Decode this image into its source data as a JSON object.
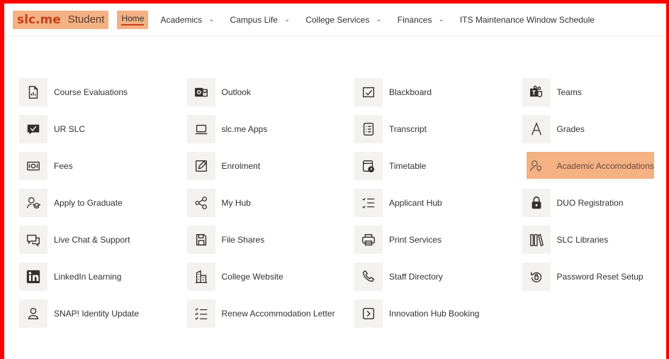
{
  "brand": {
    "logo": "slc.me",
    "name": "Student"
  },
  "nav": {
    "home": "Home",
    "items": [
      {
        "label": "Academics",
        "has_menu": true
      },
      {
        "label": "Campus Life",
        "has_menu": true
      },
      {
        "label": "College Services",
        "has_menu": true
      },
      {
        "label": "Finances",
        "has_menu": true
      },
      {
        "label": "ITS Maintenance Window Schedule",
        "has_menu": false
      }
    ]
  },
  "colors": {
    "frame": "#ff0000",
    "highlight": "#f4b183",
    "brand_text": "#c7401b"
  },
  "tiles": [
    {
      "label": "Course Evaluations",
      "icon": "document-chart-icon"
    },
    {
      "label": "Outlook",
      "icon": "outlook-icon"
    },
    {
      "label": "Blackboard",
      "icon": "blackboard-icon"
    },
    {
      "label": "Teams",
      "icon": "teams-icon"
    },
    {
      "label": "UR SLC",
      "icon": "chat-checkmark-icon"
    },
    {
      "label": "slc.me Apps",
      "icon": "laptop-icon"
    },
    {
      "label": "Transcript",
      "icon": "transcript-icon"
    },
    {
      "label": "Grades",
      "icon": "letter-a-icon"
    },
    {
      "label": "Fees",
      "icon": "money-icon"
    },
    {
      "label": "Enrolment",
      "icon": "edit-form-icon"
    },
    {
      "label": "Timetable",
      "icon": "calendar-clock-icon"
    },
    {
      "label": "Academic Accomodations",
      "icon": "person-lightbulb-icon",
      "highlighted": true
    },
    {
      "label": "Apply to Graduate",
      "icon": "person-graduation-icon"
    },
    {
      "label": "My Hub",
      "icon": "hub-nodes-icon"
    },
    {
      "label": "Applicant Hub",
      "icon": "checklist-icon"
    },
    {
      "label": "DUO Registration",
      "icon": "lock-icon"
    },
    {
      "label": "Live Chat & Support",
      "icon": "chat-bubble-icon"
    },
    {
      "label": "File Shares",
      "icon": "save-disk-icon"
    },
    {
      "label": "Print Services",
      "icon": "printer-icon"
    },
    {
      "label": "SLC Libraries",
      "icon": "library-books-icon"
    },
    {
      "label": "LinkedIn Learning",
      "icon": "linkedin-icon"
    },
    {
      "label": "College Website",
      "icon": "building-icon"
    },
    {
      "label": "Staff Directory",
      "icon": "phone-icon"
    },
    {
      "label": "Password Reset Setup",
      "icon": "password-reset-icon"
    },
    {
      "label": "SNAP! Identity Update",
      "icon": "person-icon"
    },
    {
      "label": "Renew Accommodation Letter",
      "icon": "task-list-icon"
    },
    {
      "label": "Innovation Hub Booking",
      "icon": "chevron-box-icon"
    }
  ]
}
